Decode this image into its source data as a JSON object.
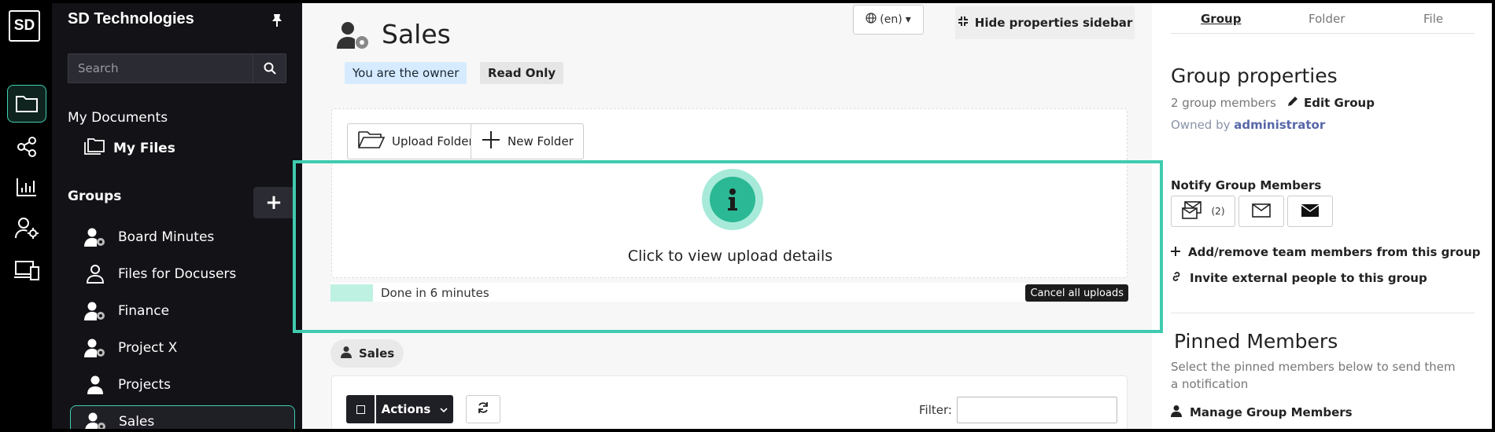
{
  "rail": {
    "logo": "SD",
    "icons": [
      "folder-icon",
      "share-icon",
      "bar-chart-icon",
      "user-settings-icon",
      "devices-icon"
    ]
  },
  "nav": {
    "brand": "SD Technologies",
    "search_placeholder": "Search",
    "my_documents": "My Documents",
    "my_files": "My Files",
    "groups_heading": "Groups",
    "groups": [
      {
        "label": "Board Minutes",
        "icon": "user-gear-icon"
      },
      {
        "label": "Files for Docusers",
        "icon": "user-outline-icon"
      },
      {
        "label": "Finance",
        "icon": "user-gear-icon"
      },
      {
        "label": "Project X",
        "icon": "user-gear-icon"
      },
      {
        "label": "Projects",
        "icon": "user-icon"
      },
      {
        "label": "Sales",
        "icon": "user-gear-icon"
      }
    ]
  },
  "main": {
    "title": "Sales",
    "badges": {
      "owner": "You are the owner",
      "readonly": "Read Only"
    },
    "language": "(en)",
    "hide_sidebar": "Hide properties sidebar",
    "upload_folder": "Upload Folder",
    "new_folder": "New Folder",
    "upload_details": "Click to view upload details",
    "progress_text": "Done in 6 minutes",
    "cancel_uploads": "Cancel all uploads",
    "breadcrumb": "Sales",
    "actions_label": "Actions",
    "filter_label": "Filter:",
    "filter_value": ""
  },
  "props": {
    "tabs": [
      "Group",
      "Folder",
      "File"
    ],
    "heading": "Group properties",
    "member_count": "2 group members",
    "edit_group": "Edit Group",
    "owned_prefix": "Owned by",
    "owner": "administrator",
    "notify_heading": "Notify Group Members",
    "notify_count": "(2)",
    "add_remove": "Add/remove team members from this group",
    "invite": "Invite external people to this group",
    "pinned_heading": "Pinned Members",
    "pinned_desc": "Select the pinned members below to send them a notification",
    "manage": "Manage Group Members"
  },
  "colors": {
    "accent": "#3fcbb0",
    "nav_bg": "#121217",
    "info": "#2bb894"
  }
}
